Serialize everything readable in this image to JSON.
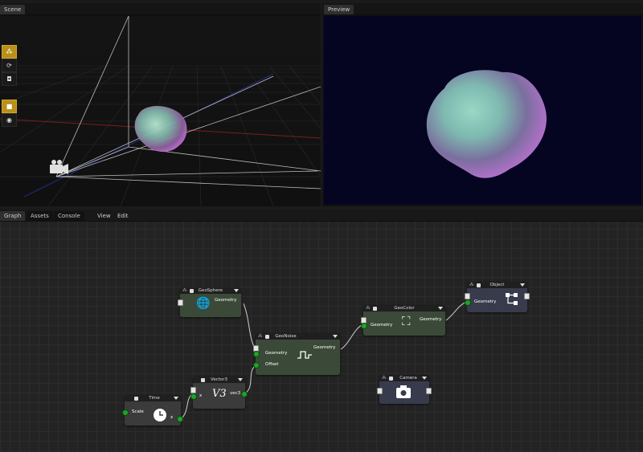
{
  "scene_tab": {
    "label": "Scene"
  },
  "preview_tab": {
    "label": "Preview"
  },
  "bottom_tabs": [
    {
      "label": "Graph"
    },
    {
      "label": "Assets"
    },
    {
      "label": "Console"
    }
  ],
  "menu": {
    "view": "View",
    "edit": "Edit"
  },
  "toolbar_icons": [
    "move-icon",
    "rotate-icon",
    "scale-icon",
    "cube-icon",
    "sphere-icon"
  ],
  "nodes": {
    "geosphere": {
      "title": "GeoSphere",
      "output": "Geometry"
    },
    "geonoise": {
      "title": "GeoNoise",
      "input_geometry": "Geometry",
      "input_offset": "Offset",
      "output": "Geometry"
    },
    "geocolor": {
      "title": "GeoColor",
      "input": "Geometry",
      "output": "Geometry"
    },
    "object": {
      "title": "Object",
      "input": "Geometry"
    },
    "camera": {
      "title": "Camera"
    },
    "vector3": {
      "title": "Vector3",
      "input": "x",
      "output": "vec3",
      "glyph": "V3"
    },
    "time": {
      "title": "Time",
      "input": "Scale",
      "output": "x"
    }
  },
  "colors": {
    "accent": "#b8901a",
    "pin": "#1fa32b",
    "geometry_node": "#3b4a38",
    "object_node": "#383b4c",
    "preview_bg": "#050522"
  }
}
